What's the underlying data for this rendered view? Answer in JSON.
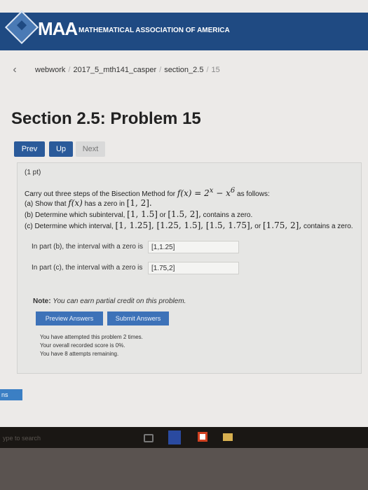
{
  "header": {
    "logo_text": "MAA",
    "org_name": "MATHEMATICAL ASSOCIATION OF AMERICA"
  },
  "breadcrumb": {
    "back_icon": "chevron-left-icon",
    "items": [
      "webwork",
      "2017_5_mth141_casper",
      "section_2.5",
      "15"
    ]
  },
  "page": {
    "title": "Section 2.5: Problem 15"
  },
  "nav": {
    "prev": "Prev",
    "up": "Up",
    "next": "Next"
  },
  "problem": {
    "points": "(1 pt)",
    "intro_a": "Carry out three steps of the Bisection Method for",
    "f_expr": "f(x) = 2",
    "exp1": "x",
    "minus": " − x",
    "exp2": "6",
    "intro_b": "as follows:",
    "part_a_pre": "(a) Show that",
    "part_a_fx": "f(x)",
    "part_a_mid": "has a zero in",
    "part_a_int": "[1, 2].",
    "part_b_pre": "(b) Determine which subinterval,",
    "part_b_int1": "[1, 1.5]",
    "part_b_or": "or",
    "part_b_int2": "[1.5, 2],",
    "part_b_post": "contains a zero.",
    "part_c_pre": "(c) Determine which interval,",
    "part_c_ints": "[1, 1.25], [1.25, 1.5], [1.5, 1.75],",
    "part_c_or": "or",
    "part_c_int4": "[1.75, 2],",
    "part_c_post": "contains a zero.",
    "answer_b_label": "In part (b), the interval with a zero is",
    "answer_b_value": "[1,1.25]",
    "answer_c_label": "In part (c), the interval with a zero is",
    "answer_c_value": "[1.75,2]",
    "note_label": "Note:",
    "note_text": "You can earn partial credit on this problem."
  },
  "actions": {
    "preview": "Preview Answers",
    "submit": "Submit Answers"
  },
  "status": {
    "line1": "You have attempted this problem 2 times.",
    "line2": "Your overall recorded score is 0%.",
    "line3": "You have 8 attempts remaining."
  },
  "side_tab": "ns",
  "taskbar": {
    "search_text": "ype to search"
  },
  "colors": {
    "header_bg": "#1f4a82",
    "button_blue": "#3d72b8",
    "nav_blue": "#2a5a9a"
  }
}
